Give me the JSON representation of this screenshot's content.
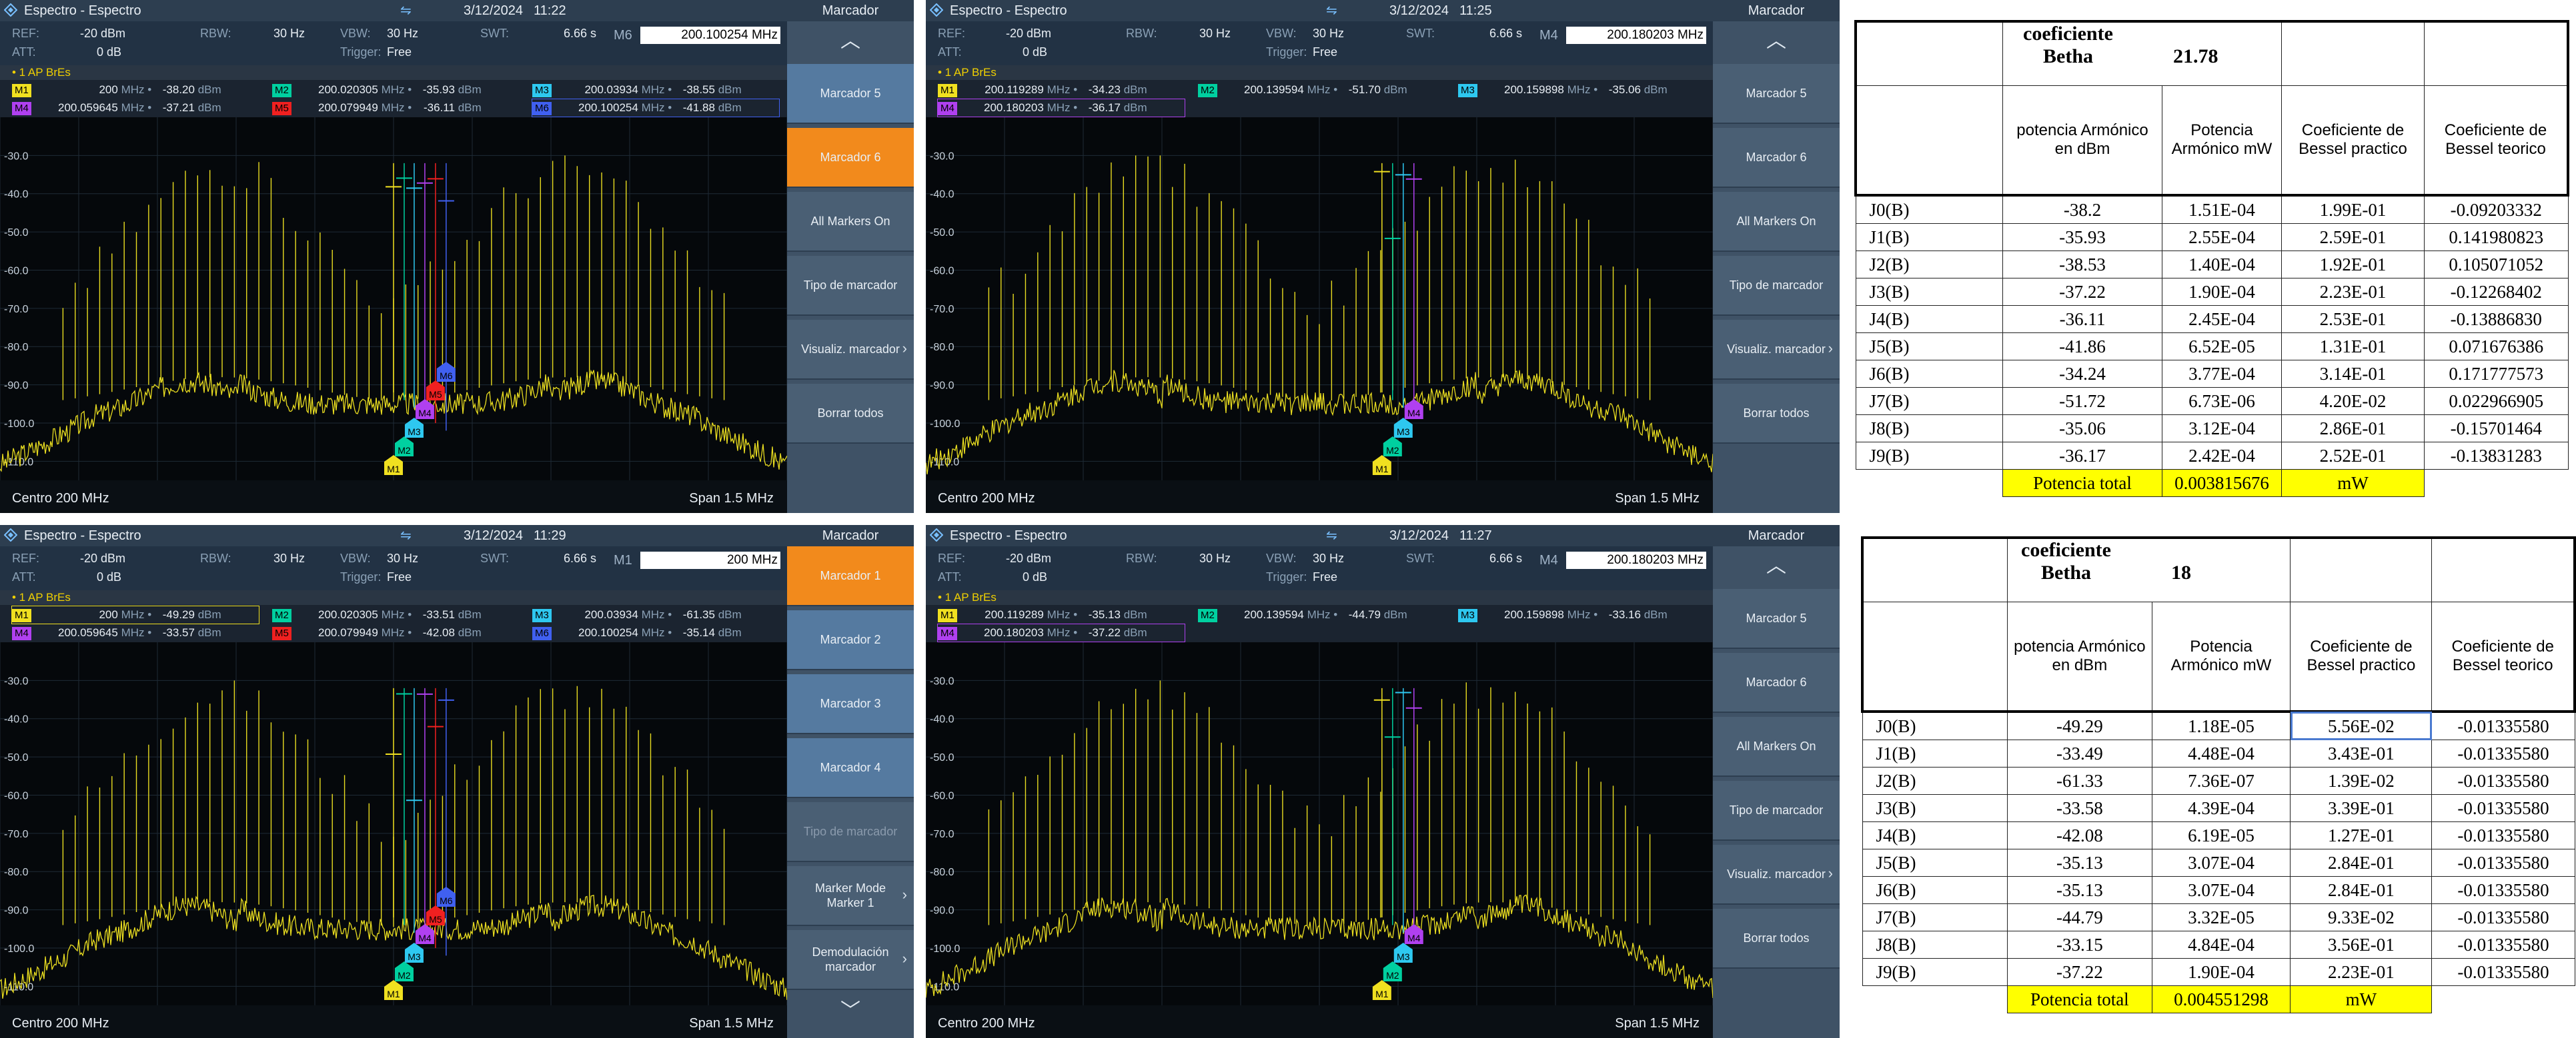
{
  "panels": [
    {
      "id": "tl",
      "title": "Espectro - Espectro",
      "date": "3/12/2024",
      "time": "11:22",
      "settings": {
        "ref_label": "REF:",
        "ref": "-20 dBm",
        "rbw_label": "RBW:",
        "rbw": "30 Hz",
        "vbw_label": "VBW:",
        "vbw": "30 Hz",
        "swt_label": "SWT:",
        "swt": "6.66 s",
        "att_label": "ATT:",
        "att": "0 dB",
        "trigger_label": "Trigger:",
        "trigger": "Free"
      },
      "marker_field": {
        "name": "M6",
        "value": "200.100254 MHz"
      },
      "trace_label": "• 1 AP BrEs",
      "markers": [
        {
          "tag": "M1",
          "freq": "200",
          "unit": "MHz",
          "level": "-38.20",
          "lunit": "dBm",
          "color": "#f0e020"
        },
        {
          "tag": "M2",
          "freq": "200.020305",
          "unit": "MHz",
          "level": "-35.93",
          "lunit": "dBm",
          "color": "#00d0a0"
        },
        {
          "tag": "M3",
          "freq": "200.03934",
          "unit": "MHz",
          "level": "-38.55",
          "lunit": "dBm",
          "color": "#2ec8f0"
        },
        {
          "tag": "M4",
          "freq": "200.059645",
          "unit": "MHz",
          "level": "-37.21",
          "lunit": "dBm",
          "color": "#b040f0"
        },
        {
          "tag": "M5",
          "freq": "200.079949",
          "unit": "MHz",
          "level": "-36.11",
          "lunit": "dBm",
          "color": "#f02020"
        },
        {
          "tag": "M6",
          "freq": "200.100254",
          "unit": "MHz",
          "level": "-41.88",
          "lunit": "dBm",
          "color": "#4060f0"
        }
      ],
      "footer": {
        "center": "Centro 200 MHz",
        "span": "Span 1.5 MHz"
      },
      "side": {
        "title": "Marcador",
        "buttons": [
          {
            "label": "Marcador 5",
            "style": "blue"
          },
          {
            "label": "Marcador 6",
            "style": "active"
          },
          {
            "label": "All Markers On",
            "style": ""
          },
          {
            "label": "Tipo de marcador",
            "style": ""
          },
          {
            "label": "Visualiz. marcador",
            "style": "",
            "chevron": "›"
          },
          {
            "label": "Borrar todos",
            "style": ""
          }
        ],
        "up_arrow": "︿"
      }
    },
    {
      "id": "tr",
      "title": "Espectro - Espectro",
      "date": "3/12/2024",
      "time": "11:25",
      "settings": {
        "ref_label": "REF:",
        "ref": "-20 dBm",
        "rbw_label": "RBW:",
        "rbw": "30 Hz",
        "vbw_label": "VBW:",
        "vbw": "30 Hz",
        "swt_label": "SWT:",
        "swt": "6.66 s",
        "att_label": "ATT:",
        "att": "0 dB",
        "trigger_label": "Trigger:",
        "trigger": "Free"
      },
      "marker_field": {
        "name": "M4",
        "value": "200.180203 MHz"
      },
      "trace_label": "• 1 AP BrEs",
      "markers": [
        {
          "tag": "M1",
          "freq": "200.119289",
          "unit": "MHz",
          "level": "-34.23",
          "lunit": "dBm",
          "color": "#f0e020"
        },
        {
          "tag": "M2",
          "freq": "200.139594",
          "unit": "MHz",
          "level": "-51.70",
          "lunit": "dBm",
          "color": "#00d0a0"
        },
        {
          "tag": "M3",
          "freq": "200.159898",
          "unit": "MHz",
          "level": "-35.06",
          "lunit": "dBm",
          "color": "#2ec8f0"
        },
        {
          "tag": "M4",
          "freq": "200.180203",
          "unit": "MHz",
          "level": "-36.17",
          "lunit": "dBm",
          "color": "#b040f0"
        }
      ],
      "footer": {
        "center": "Centro 200 MHz",
        "span": "Span 1.5 MHz"
      },
      "side": {
        "title": "Marcador",
        "buttons": [
          {
            "label": "Marcador 5",
            "style": ""
          },
          {
            "label": "Marcador 6",
            "style": ""
          },
          {
            "label": "All Markers On",
            "style": ""
          },
          {
            "label": "Tipo de marcador",
            "style": ""
          },
          {
            "label": "Visualiz. marcador",
            "style": "",
            "chevron": "›"
          },
          {
            "label": "Borrar todos",
            "style": ""
          }
        ],
        "up_arrow": "︿"
      }
    },
    {
      "id": "bl",
      "title": "Espectro - Espectro",
      "date": "3/12/2024",
      "time": "11:29",
      "settings": {
        "ref_label": "REF:",
        "ref": "-20 dBm",
        "rbw_label": "RBW:",
        "rbw": "30 Hz",
        "vbw_label": "VBW:",
        "vbw": "30 Hz",
        "swt_label": "SWT:",
        "swt": "6.66 s",
        "att_label": "ATT:",
        "att": "0 dB",
        "trigger_label": "Trigger:",
        "trigger": "Free"
      },
      "marker_field": {
        "name": "M1",
        "value": "200 MHz"
      },
      "trace_label": "• 1 AP BrEs",
      "markers": [
        {
          "tag": "M1",
          "freq": "200",
          "unit": "MHz",
          "level": "-49.29",
          "lunit": "dBm",
          "color": "#f0e020"
        },
        {
          "tag": "M2",
          "freq": "200.020305",
          "unit": "MHz",
          "level": "-33.51",
          "lunit": "dBm",
          "color": "#00d0a0"
        },
        {
          "tag": "M3",
          "freq": "200.03934",
          "unit": "MHz",
          "level": "-61.35",
          "lunit": "dBm",
          "color": "#2ec8f0"
        },
        {
          "tag": "M4",
          "freq": "200.059645",
          "unit": "MHz",
          "level": "-33.57",
          "lunit": "dBm",
          "color": "#b040f0"
        },
        {
          "tag": "M5",
          "freq": "200.079949",
          "unit": "MHz",
          "level": "-42.08",
          "lunit": "dBm",
          "color": "#f02020"
        },
        {
          "tag": "M6",
          "freq": "200.100254",
          "unit": "MHz",
          "level": "-35.14",
          "lunit": "dBm",
          "color": "#4060f0"
        }
      ],
      "footer": {
        "center": "Centro 200 MHz",
        "span": "Span 1.5 MHz"
      },
      "side": {
        "title": "Marcador",
        "buttons": [
          {
            "label": "Marcador 1",
            "style": "active"
          },
          {
            "label": "Marcador 2",
            "style": "blue"
          },
          {
            "label": "Marcador 3",
            "style": "blue"
          },
          {
            "label": "Marcador 4",
            "style": "blue"
          },
          {
            "label": "Tipo de marcador",
            "style": "dis"
          },
          {
            "label": "Marker Mode Marker 1",
            "style": "",
            "chevron": "›"
          },
          {
            "label": "Demodulación marcador",
            "style": "",
            "chevron": "›"
          }
        ],
        "down_arrow": "﹀"
      }
    },
    {
      "id": "br",
      "title": "Espectro - Espectro",
      "date": "3/12/2024",
      "time": "11:27",
      "settings": {
        "ref_label": "REF:",
        "ref": "-20 dBm",
        "rbw_label": "RBW:",
        "rbw": "30 Hz",
        "vbw_label": "VBW:",
        "vbw": "30 Hz",
        "swt_label": "SWT:",
        "swt": "6.66 s",
        "att_label": "ATT:",
        "att": "0 dB",
        "trigger_label": "Trigger:",
        "trigger": "Free"
      },
      "marker_field": {
        "name": "M4",
        "value": "200.180203 MHz"
      },
      "trace_label": "• 1 AP BrEs",
      "markers": [
        {
          "tag": "M1",
          "freq": "200.119289",
          "unit": "MHz",
          "level": "-35.13",
          "lunit": "dBm",
          "color": "#f0e020"
        },
        {
          "tag": "M2",
          "freq": "200.139594",
          "unit": "MHz",
          "level": "-44.79",
          "lunit": "dBm",
          "color": "#00d0a0"
        },
        {
          "tag": "M3",
          "freq": "200.159898",
          "unit": "MHz",
          "level": "-33.16",
          "lunit": "dBm",
          "color": "#2ec8f0"
        },
        {
          "tag": "M4",
          "freq": "200.180203",
          "unit": "MHz",
          "level": "-37.22",
          "lunit": "dBm",
          "color": "#b040f0"
        }
      ],
      "footer": {
        "center": "Centro 200 MHz",
        "span": "Span 1.5 MHz"
      },
      "side": {
        "title": "Marcador",
        "buttons": [
          {
            "label": "Marcador 5",
            "style": ""
          },
          {
            "label": "Marcador 6",
            "style": ""
          },
          {
            "label": "All Markers On",
            "style": ""
          },
          {
            "label": "Tipo de marcador",
            "style": ""
          },
          {
            "label": "Visualiz. marcador",
            "style": "",
            "chevron": "›"
          },
          {
            "label": "Borrar todos",
            "style": ""
          }
        ],
        "up_arrow": "︿"
      }
    }
  ],
  "y_ticks": [
    "-30.0",
    "-40.0",
    "-50.0",
    "-60.0",
    "-70.0",
    "-80.0",
    "-90.0",
    "-100.0",
    "-110.0"
  ],
  "sheets": [
    {
      "id": "s1",
      "coef_label": "coeficiente",
      "betha_label": "Betha",
      "betha_value": "21.78",
      "headers": [
        "potencia Armónico en dBm",
        "Potencia Armónico mW",
        "Coeficiente de Bessel practico",
        "Coeficiente de Bessel teorico"
      ],
      "rows": [
        [
          "J0(B)",
          "-38.2",
          "1.51E-04",
          "1.99E-01",
          "-0.09203332"
        ],
        [
          "J1(B)",
          "-35.93",
          "2.55E-04",
          "2.59E-01",
          "0.141980823"
        ],
        [
          "J2(B)",
          "-38.53",
          "1.40E-04",
          "1.92E-01",
          "0.105071052"
        ],
        [
          "J3(B)",
          "-37.22",
          "1.90E-04",
          "2.23E-01",
          "-0.12268402"
        ],
        [
          "J4(B)",
          "-36.11",
          "2.45E-04",
          "2.53E-01",
          "-0.13886830"
        ],
        [
          "J5(B)",
          "-41.86",
          "6.52E-05",
          "1.31E-01",
          "0.071676386"
        ],
        [
          "J6(B)",
          "-34.24",
          "3.77E-04",
          "3.14E-01",
          "0.171777573"
        ],
        [
          "J7(B)",
          "-51.72",
          "6.73E-06",
          "4.20E-02",
          "0.022966905"
        ],
        [
          "J8(B)",
          "-35.06",
          "3.12E-04",
          "2.86E-01",
          "-0.15701464"
        ],
        [
          "J9(B)",
          "-36.17",
          "2.42E-04",
          "2.52E-01",
          "-0.13831283"
        ]
      ],
      "total_label": "Potencia total",
      "total_value": "0.003815676",
      "total_unit": "mW"
    },
    {
      "id": "s2",
      "coef_label": "coeficiente",
      "betha_label": "Betha",
      "betha_value": "18",
      "headers": [
        "potencia Armónico en dBm",
        "Potencia Armónico mW",
        "Coeficiente de Bessel practico",
        "Coeficiente de Bessel teorico"
      ],
      "rows": [
        [
          "J0(B)",
          "-49.29",
          "1.18E-05",
          "5.56E-02",
          "-0.01335580"
        ],
        [
          "J1(B)",
          "-33.49",
          "4.48E-04",
          "3.43E-01",
          "-0.01335580"
        ],
        [
          "J2(B)",
          "-61.33",
          "7.36E-07",
          "1.39E-02",
          "-0.01335580"
        ],
        [
          "J3(B)",
          "-33.58",
          "4.39E-04",
          "3.39E-01",
          "-0.01335580"
        ],
        [
          "J4(B)",
          "-42.08",
          "6.19E-05",
          "1.27E-01",
          "-0.01335580"
        ],
        [
          "J5(B)",
          "-35.13",
          "3.07E-04",
          "2.84E-01",
          "-0.01335580"
        ],
        [
          "J6(B)",
          "-35.13",
          "3.07E-04",
          "2.84E-01",
          "-0.01335580"
        ],
        [
          "J7(B)",
          "-44.79",
          "3.32E-05",
          "9.33E-02",
          "-0.01335580"
        ],
        [
          "J8(B)",
          "-33.15",
          "4.84E-04",
          "3.56E-01",
          "-0.01335580"
        ],
        [
          "J9(B)",
          "-37.22",
          "1.90E-04",
          "2.23E-01",
          "-0.01335580"
        ]
      ],
      "total_label": "Potencia total",
      "total_value": "0.004551298",
      "total_unit": "mW"
    }
  ]
}
